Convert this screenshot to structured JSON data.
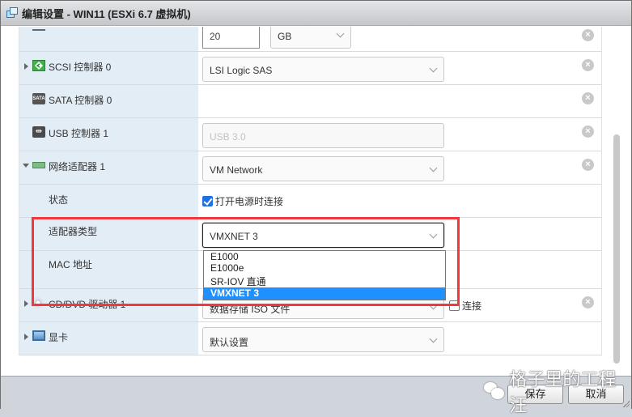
{
  "window": {
    "title": "编辑设置 - WIN11 (ESXi 6.7 虚拟机)",
    "icon": "vm-window-icon"
  },
  "rows": {
    "disk": {
      "size_value": "20",
      "size_unit": "GB"
    },
    "scsi": {
      "label": "SCSI 控制器 0",
      "icon": "scsi-controller-icon",
      "value": "LSI Logic SAS"
    },
    "sata": {
      "label": "SATA 控制器 0",
      "icon": "sata-controller-icon"
    },
    "usb": {
      "label": "USB 控制器 1",
      "icon": "usb-controller-icon",
      "value": "USB 3.0"
    },
    "network": {
      "label": "网络适配器 1",
      "icon": "network-adapter-icon",
      "value": "VM Network",
      "status_label": "状态",
      "status_checkbox_label": "打开电源时连接",
      "status_checked": true,
      "adapter_type_label": "适配器类型",
      "adapter_type_value": "VMXNET 3",
      "adapter_type_options": [
        "E1000",
        "E1000e",
        "SR-IOV 直通",
        "VMXNET 3"
      ],
      "adapter_type_selected_index": 3,
      "mac_label": "MAC 地址"
    },
    "cdrom": {
      "label": "CD/DVD 驱动器 1",
      "icon": "cd-dvd-icon",
      "value": "数据存储 ISO 文件",
      "connect_label": "连接",
      "connect_checked": false
    },
    "video": {
      "label": "显卡",
      "icon": "display-card-icon",
      "value": "默认设置"
    }
  },
  "footer": {
    "save_label": "保存",
    "cancel_label": "取消"
  },
  "watermark": {
    "text": "格子里的工程汪"
  },
  "colors": {
    "label_column_bg": "#e3edf6",
    "highlight_box": "#f0383d",
    "selected_option": "#1e90ff"
  }
}
